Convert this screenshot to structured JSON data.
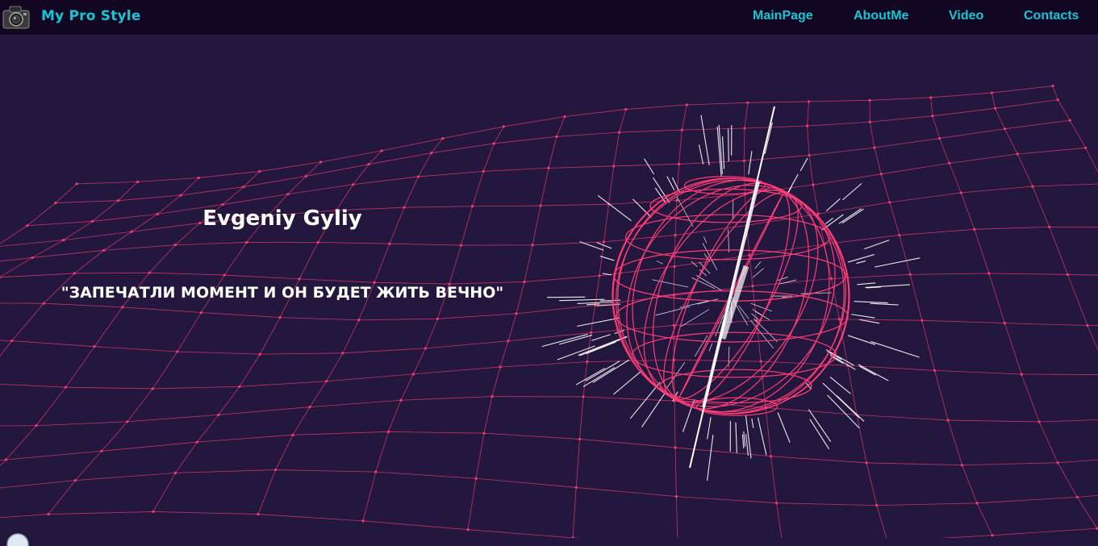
{
  "navbar": {
    "brand": "My Pro Style",
    "logo_icon": "camera-icon",
    "links": [
      {
        "label": "MainPage"
      },
      {
        "label": "AboutMe"
      },
      {
        "label": "Video"
      },
      {
        "label": "Contacts"
      }
    ]
  },
  "hero": {
    "name": "Evgeniy Gyliy",
    "quote": "\"ЗАПЕЧАТЛИ МОМЕНТ И ОН БУДЕТ ЖИТЬ ВЕЧНО\""
  },
  "colors": {
    "background": "#23173d",
    "navbar": "#120722",
    "accent": "#17c6d4",
    "grid": "#e0386f",
    "sphere": "#ff3d78",
    "spikes": "#ffffff"
  }
}
